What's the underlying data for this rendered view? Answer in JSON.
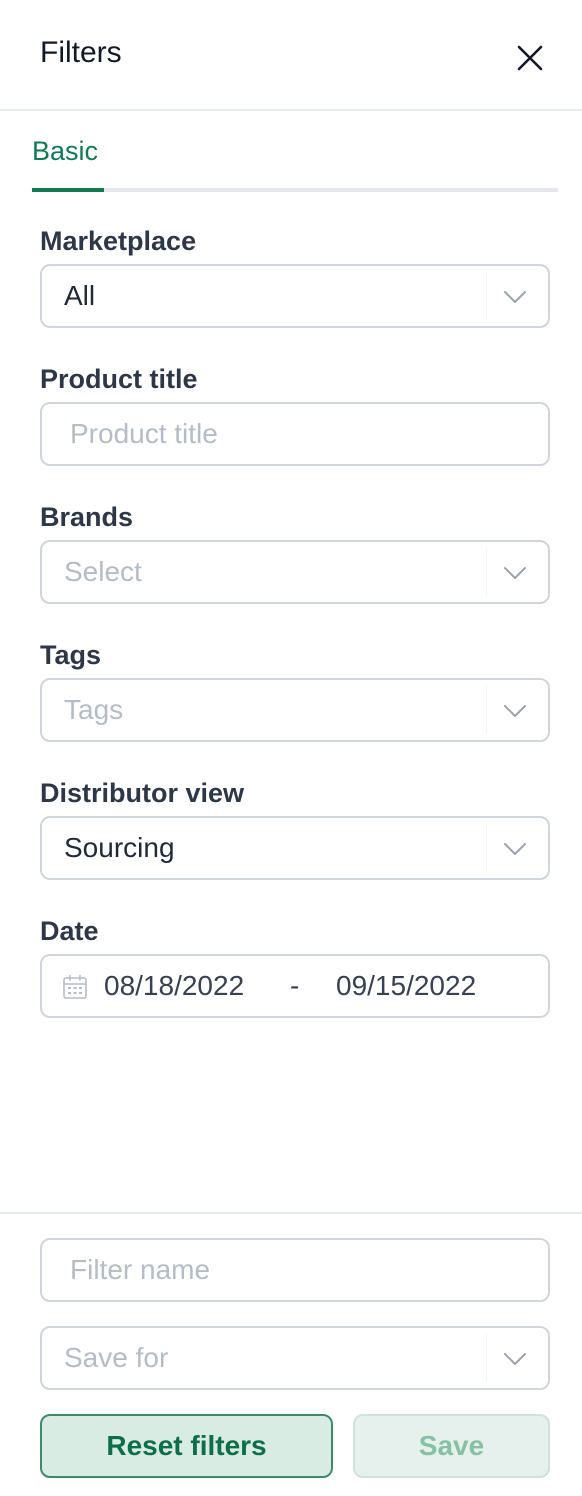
{
  "header": {
    "title": "Filters"
  },
  "tabs": [
    {
      "label": "Basic",
      "active": true
    }
  ],
  "fields": {
    "marketplace": {
      "label": "Marketplace",
      "value": "All"
    },
    "product_title": {
      "label": "Product title",
      "placeholder": "Product title"
    },
    "brands": {
      "label": "Brands",
      "placeholder": "Select"
    },
    "tags": {
      "label": "Tags",
      "placeholder": "Tags"
    },
    "distributor_view": {
      "label": "Distributor view",
      "value": "Sourcing"
    },
    "date": {
      "label": "Date",
      "from": "08/18/2022",
      "separator": "-",
      "to": "09/15/2022"
    }
  },
  "footer": {
    "filter_name_placeholder": "Filter name",
    "save_for_placeholder": "Save for",
    "reset_label": "Reset filters",
    "save_label": "Save"
  },
  "colors": {
    "accent": "#117a53",
    "border": "#d1d5db",
    "placeholder": "#b5bcc6",
    "reset_bg": "#d8ece4",
    "save_bg_disabled": "#e6f1ed"
  },
  "icons": {
    "close": "close-icon",
    "chevron": "chevron-down-icon",
    "calendar": "calendar-icon"
  }
}
